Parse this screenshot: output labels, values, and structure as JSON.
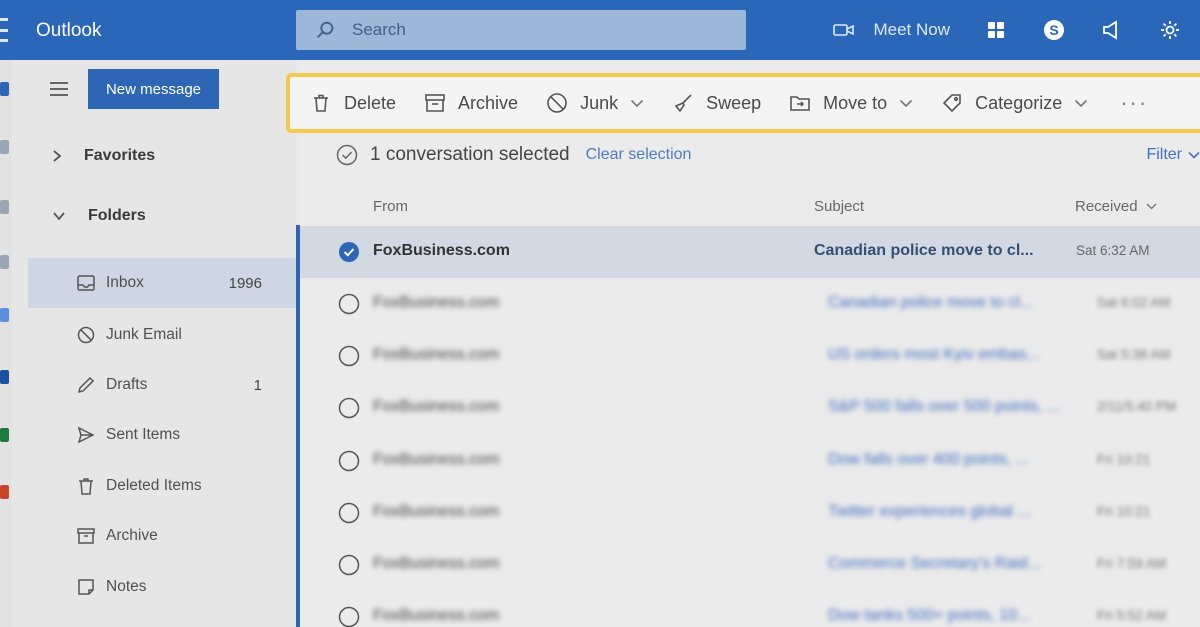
{
  "app": {
    "title": "Outlook"
  },
  "search": {
    "placeholder": "Search"
  },
  "topbar": {
    "meet_now": "Meet Now"
  },
  "folder_pane": {
    "new_message": "New message",
    "favorites": "Favorites",
    "folders": "Folders",
    "items": [
      {
        "label": "Inbox",
        "count": "1996",
        "icon": "inbox-icon",
        "selected": true
      },
      {
        "label": "Junk Email",
        "count": "",
        "icon": "junk-icon"
      },
      {
        "label": "Drafts",
        "count": "1",
        "icon": "pencil-icon"
      },
      {
        "label": "Sent Items",
        "count": "",
        "icon": "send-icon"
      },
      {
        "label": "Deleted Items",
        "count": "",
        "icon": "trash-icon"
      },
      {
        "label": "Archive",
        "count": "",
        "icon": "archive-icon"
      },
      {
        "label": "Notes",
        "count": "",
        "icon": "note-icon"
      }
    ]
  },
  "toolbar": {
    "delete": "Delete",
    "archive": "Archive",
    "junk": "Junk",
    "sweep": "Sweep",
    "move_to": "Move to",
    "categorize": "Categorize",
    "more": "···"
  },
  "selection": {
    "text": "1 conversation selected",
    "clear": "Clear selection",
    "filter": "Filter"
  },
  "columns": {
    "from": "From",
    "subject": "Subject",
    "received": "Received"
  },
  "messages": [
    {
      "from": "FoxBusiness.com",
      "subject": "Canadian police move to cl...",
      "received": "Sat 6:32 AM",
      "selected": true
    },
    {
      "from": "FoxBusiness.com",
      "subject": "Canadian police move to cl...",
      "received": "Sat 6:02 AM"
    },
    {
      "from": "FoxBusiness.com",
      "subject": "US orders most Kyiv embas...",
      "received": "Sat 5:38 AM"
    },
    {
      "from": "FoxBusiness.com",
      "subject": "S&P 500 falls over 500 points, ...",
      "received": "2/11/5:40 PM"
    },
    {
      "from": "FoxBusiness.com",
      "subject": "Dow falls over 400 points, ...",
      "received": "Fri 10:21"
    },
    {
      "from": "FoxBusiness.com",
      "subject": "Twitter experiences global ...",
      "received": "Fri 10:21"
    },
    {
      "from": "FoxBusiness.com",
      "subject": "Commerce Secretary's Raid...",
      "received": "Fri 7:59 AM"
    },
    {
      "from": "FoxBusiness.com",
      "subject": "Dow tanks 500+ points, 10...",
      "received": "Fri 5:52 AM"
    }
  ],
  "colors": {
    "brand": "#2a67b8",
    "highlight": "#f4c94c",
    "selected_row": "#d2d9e3"
  }
}
